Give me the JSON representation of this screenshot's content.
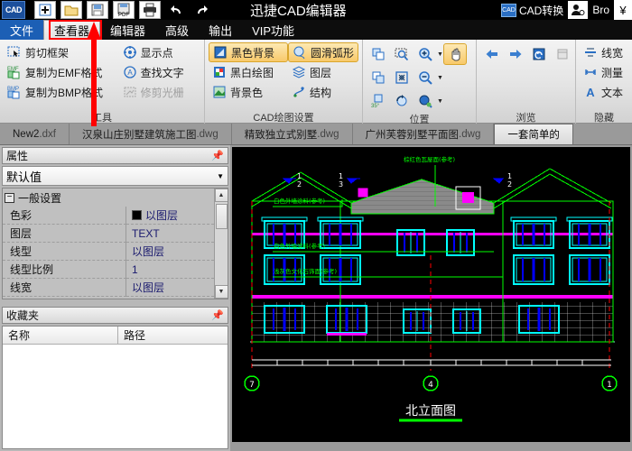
{
  "titlebar": {
    "logo": "CAD",
    "app_title": "迅捷CAD编辑器",
    "quick_access": [
      {
        "name": "new-icon",
        "label": "新建"
      },
      {
        "name": "open-icon",
        "label": "打开"
      },
      {
        "name": "save-icon",
        "label": "保存"
      },
      {
        "name": "save-pdf-icon",
        "label": "另存为PDF"
      },
      {
        "name": "print-icon",
        "label": "打印"
      },
      {
        "name": "undo-icon",
        "label": "撤销"
      },
      {
        "name": "redo-icon",
        "label": "重做"
      }
    ],
    "cad_convert": "CAD转换",
    "account": "Bro",
    "currency": "¥"
  },
  "menu": {
    "tabs": [
      {
        "label": "文件",
        "state": "file"
      },
      {
        "label": "查看器",
        "state": "active"
      },
      {
        "label": "编辑器",
        "state": "normal"
      },
      {
        "label": "高级",
        "state": "normal"
      },
      {
        "label": "输出",
        "state": "normal"
      },
      {
        "label": "VIP功能",
        "state": "normal"
      }
    ]
  },
  "ribbon": {
    "groups": [
      {
        "label": "工具",
        "columns": [
          [
            {
              "label": "剪切框架",
              "icon": "crop-frame-icon",
              "state": "normal"
            },
            {
              "label": "复制为EMF格式",
              "icon": "emf-copy-icon",
              "state": "normal"
            },
            {
              "label": "复制为BMP格式",
              "icon": "bmp-copy-icon",
              "state": "normal"
            }
          ],
          [
            {
              "label": "显示点",
              "icon": "show-point-icon",
              "state": "normal"
            },
            {
              "label": "查找文字",
              "icon": "find-text-icon",
              "state": "normal"
            },
            {
              "label": "修剪光栅",
              "icon": "trim-raster-icon",
              "state": "disabled"
            }
          ]
        ]
      },
      {
        "label": "CAD绘图设置",
        "columns": [
          [
            {
              "label": "黑色背景",
              "icon": "black-background-icon",
              "state": "checked"
            },
            {
              "label": "黑白绘图",
              "icon": "monochrome-icon",
              "state": "normal"
            },
            {
              "label": "背景色",
              "icon": "background-color-icon",
              "state": "normal"
            }
          ],
          [
            {
              "label": "圆滑弧形",
              "icon": "smooth-arc-icon",
              "state": "checked"
            },
            {
              "label": "图层",
              "icon": "layers-icon",
              "state": "normal"
            },
            {
              "label": "结构",
              "icon": "structure-icon",
              "state": "normal"
            }
          ]
        ]
      },
      {
        "label": "位置",
        "icon_rows": [
          [
            {
              "icon": "copy-view-icon",
              "state": "normal"
            },
            {
              "icon": "zoom-window-icon",
              "state": "normal"
            },
            {
              "icon": "zoom-in-icon",
              "state": "normal",
              "dropdown": true
            },
            {
              "icon": "pan-hand-icon",
              "state": "checked"
            }
          ],
          [
            {
              "icon": "paste-view-icon",
              "state": "normal"
            },
            {
              "icon": "zoom-extents-icon",
              "state": "normal"
            },
            {
              "icon": "zoom-out-icon",
              "state": "normal",
              "dropdown": true
            }
          ],
          [
            {
              "icon": "rotate-35-icon",
              "state": "normal"
            },
            {
              "icon": "rotate-view-icon",
              "state": "normal"
            },
            {
              "icon": "zoom-preset-icon",
              "state": "normal",
              "dropdown": true
            }
          ]
        ]
      },
      {
        "label": "浏览",
        "icon_rows": [
          [
            {
              "icon": "arrow-left-icon",
              "state": "normal"
            },
            {
              "icon": "arrow-right-icon",
              "state": "normal"
            },
            {
              "icon": "refresh-view-icon",
              "state": "normal"
            },
            {
              "icon": "window-view-icon",
              "state": "disabled"
            }
          ]
        ]
      },
      {
        "label": "隐藏",
        "columns": [
          [
            {
              "label": "线宽",
              "icon": "linewidth-icon",
              "state": "normal"
            },
            {
              "label": "测量",
              "icon": "measure-icon",
              "state": "normal"
            },
            {
              "label": "文本",
              "icon": "text-icon",
              "state": "normal"
            }
          ]
        ]
      }
    ]
  },
  "doctabs": [
    {
      "name": "New2",
      "ext": ".dxf",
      "active": false
    },
    {
      "name": "汉泉山庄别墅建筑施工图",
      "ext": ".dwg",
      "active": false
    },
    {
      "name": "精致独立式别墅",
      "ext": ".dwg",
      "active": false
    },
    {
      "name": "广州芙蓉别墅平面图",
      "ext": ".dwg",
      "active": false
    },
    {
      "name": "一套简单的",
      "ext": "",
      "active": true
    }
  ],
  "properties_panel": {
    "title": "属性",
    "pin": "📌",
    "selector_value": "默认值",
    "group_label": "一般设置",
    "rows": [
      {
        "name": "色彩",
        "value": "以图层",
        "swatch": "#000000"
      },
      {
        "name": "图层",
        "value": "TEXT",
        "swatch": null
      },
      {
        "name": "线型",
        "value": "以图层",
        "swatch": null
      },
      {
        "name": "线型比例",
        "value": "1",
        "swatch": null
      },
      {
        "name": "线宽",
        "value": "以图层",
        "swatch": null
      }
    ]
  },
  "favorites_panel": {
    "title": "收藏夹",
    "pin": "📌",
    "columns": [
      "名称",
      "路径"
    ],
    "rows": []
  },
  "drawing": {
    "title": "北立面图",
    "annotations": [
      {
        "text": "白色外墙涂料(参考)",
        "color": "#00ff00"
      },
      {
        "text": "白色外墙涂料(参考)",
        "color": "#00ff00"
      },
      {
        "text": "浅灰色文化石饰面(参考)",
        "color": "#00ff00"
      },
      {
        "text": "棕红色瓦屋面(参考)",
        "color": "#00ff00"
      }
    ],
    "grid_bubbles": [
      "7",
      "4",
      "1"
    ],
    "section_marks": [
      "1",
      "2",
      "1",
      "3",
      "1",
      "2"
    ],
    "colors": {
      "background": "#000000",
      "wall": "#00ff00",
      "window": "#00ffff",
      "window_inner": "#0000ff",
      "band": "#ff00ff",
      "axis": "#ff0000",
      "text": "#ffffff",
      "brick": "#c8c8c8"
    }
  },
  "overlay": {
    "highlight_target": "查看器",
    "arrow_color": "#ff0000"
  }
}
